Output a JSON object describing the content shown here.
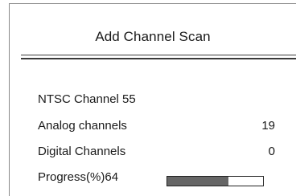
{
  "dialog": {
    "title": "Add Channel Scan",
    "channel_status": "NTSC Channel 55",
    "analog": {
      "label": "Analog channels",
      "value": "19"
    },
    "digital": {
      "label": "Digital Channels",
      "value": "0"
    },
    "progress": {
      "label": "Progress(%)64",
      "percent": 64
    }
  },
  "colors": {
    "progress_fill": "#666666",
    "rule": "#3a3a3a",
    "frame": "#8a8a8a"
  }
}
